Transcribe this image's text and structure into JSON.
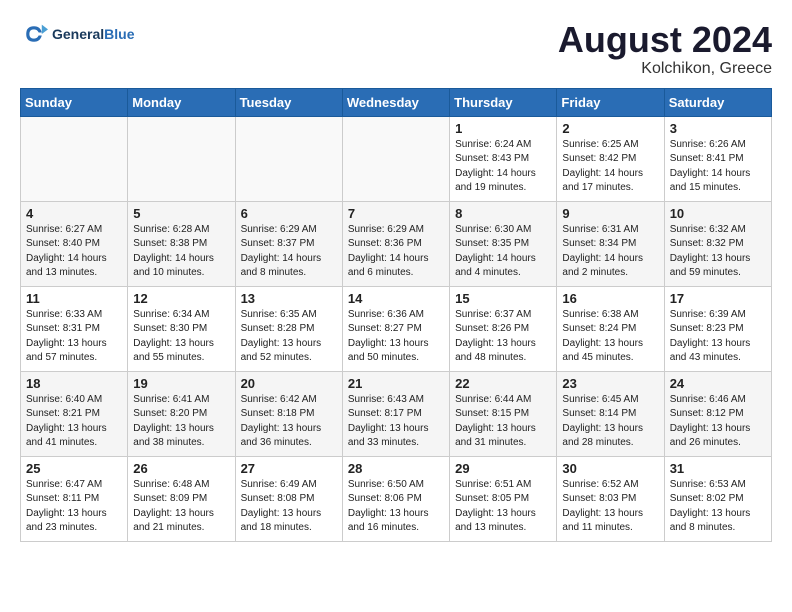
{
  "header": {
    "logo_line1": "General",
    "logo_line2": "Blue",
    "month_year": "August 2024",
    "location": "Kolchikon, Greece"
  },
  "days_of_week": [
    "Sunday",
    "Monday",
    "Tuesday",
    "Wednesday",
    "Thursday",
    "Friday",
    "Saturday"
  ],
  "weeks": [
    {
      "days": [
        {
          "num": "",
          "empty": true
        },
        {
          "num": "",
          "empty": true
        },
        {
          "num": "",
          "empty": true
        },
        {
          "num": "",
          "empty": true
        },
        {
          "num": "1",
          "sunrise": "6:24 AM",
          "sunset": "8:43 PM",
          "daylight": "14 hours and 19 minutes."
        },
        {
          "num": "2",
          "sunrise": "6:25 AM",
          "sunset": "8:42 PM",
          "daylight": "14 hours and 17 minutes."
        },
        {
          "num": "3",
          "sunrise": "6:26 AM",
          "sunset": "8:41 PM",
          "daylight": "14 hours and 15 minutes."
        }
      ]
    },
    {
      "days": [
        {
          "num": "4",
          "sunrise": "6:27 AM",
          "sunset": "8:40 PM",
          "daylight": "14 hours and 13 minutes."
        },
        {
          "num": "5",
          "sunrise": "6:28 AM",
          "sunset": "8:38 PM",
          "daylight": "14 hours and 10 minutes."
        },
        {
          "num": "6",
          "sunrise": "6:29 AM",
          "sunset": "8:37 PM",
          "daylight": "14 hours and 8 minutes."
        },
        {
          "num": "7",
          "sunrise": "6:29 AM",
          "sunset": "8:36 PM",
          "daylight": "14 hours and 6 minutes."
        },
        {
          "num": "8",
          "sunrise": "6:30 AM",
          "sunset": "8:35 PM",
          "daylight": "14 hours and 4 minutes."
        },
        {
          "num": "9",
          "sunrise": "6:31 AM",
          "sunset": "8:34 PM",
          "daylight": "14 hours and 2 minutes."
        },
        {
          "num": "10",
          "sunrise": "6:32 AM",
          "sunset": "8:32 PM",
          "daylight": "13 hours and 59 minutes."
        }
      ]
    },
    {
      "days": [
        {
          "num": "11",
          "sunrise": "6:33 AM",
          "sunset": "8:31 PM",
          "daylight": "13 hours and 57 minutes."
        },
        {
          "num": "12",
          "sunrise": "6:34 AM",
          "sunset": "8:30 PM",
          "daylight": "13 hours and 55 minutes."
        },
        {
          "num": "13",
          "sunrise": "6:35 AM",
          "sunset": "8:28 PM",
          "daylight": "13 hours and 52 minutes."
        },
        {
          "num": "14",
          "sunrise": "6:36 AM",
          "sunset": "8:27 PM",
          "daylight": "13 hours and 50 minutes."
        },
        {
          "num": "15",
          "sunrise": "6:37 AM",
          "sunset": "8:26 PM",
          "daylight": "13 hours and 48 minutes."
        },
        {
          "num": "16",
          "sunrise": "6:38 AM",
          "sunset": "8:24 PM",
          "daylight": "13 hours and 45 minutes."
        },
        {
          "num": "17",
          "sunrise": "6:39 AM",
          "sunset": "8:23 PM",
          "daylight": "13 hours and 43 minutes."
        }
      ]
    },
    {
      "days": [
        {
          "num": "18",
          "sunrise": "6:40 AM",
          "sunset": "8:21 PM",
          "daylight": "13 hours and 41 minutes."
        },
        {
          "num": "19",
          "sunrise": "6:41 AM",
          "sunset": "8:20 PM",
          "daylight": "13 hours and 38 minutes."
        },
        {
          "num": "20",
          "sunrise": "6:42 AM",
          "sunset": "8:18 PM",
          "daylight": "13 hours and 36 minutes."
        },
        {
          "num": "21",
          "sunrise": "6:43 AM",
          "sunset": "8:17 PM",
          "daylight": "13 hours and 33 minutes."
        },
        {
          "num": "22",
          "sunrise": "6:44 AM",
          "sunset": "8:15 PM",
          "daylight": "13 hours and 31 minutes."
        },
        {
          "num": "23",
          "sunrise": "6:45 AM",
          "sunset": "8:14 PM",
          "daylight": "13 hours and 28 minutes."
        },
        {
          "num": "24",
          "sunrise": "6:46 AM",
          "sunset": "8:12 PM",
          "daylight": "13 hours and 26 minutes."
        }
      ]
    },
    {
      "days": [
        {
          "num": "25",
          "sunrise": "6:47 AM",
          "sunset": "8:11 PM",
          "daylight": "13 hours and 23 minutes."
        },
        {
          "num": "26",
          "sunrise": "6:48 AM",
          "sunset": "8:09 PM",
          "daylight": "13 hours and 21 minutes."
        },
        {
          "num": "27",
          "sunrise": "6:49 AM",
          "sunset": "8:08 PM",
          "daylight": "13 hours and 18 minutes."
        },
        {
          "num": "28",
          "sunrise": "6:50 AM",
          "sunset": "8:06 PM",
          "daylight": "13 hours and 16 minutes."
        },
        {
          "num": "29",
          "sunrise": "6:51 AM",
          "sunset": "8:05 PM",
          "daylight": "13 hours and 13 minutes."
        },
        {
          "num": "30",
          "sunrise": "6:52 AM",
          "sunset": "8:03 PM",
          "daylight": "13 hours and 11 minutes."
        },
        {
          "num": "31",
          "sunrise": "6:53 AM",
          "sunset": "8:02 PM",
          "daylight": "13 hours and 8 minutes."
        }
      ]
    }
  ],
  "labels": {
    "sunrise": "Sunrise:",
    "sunset": "Sunset:",
    "daylight": "Daylight:"
  }
}
